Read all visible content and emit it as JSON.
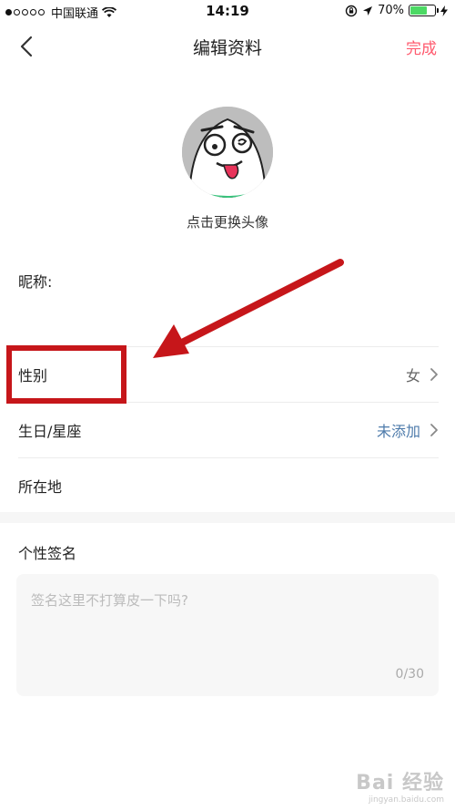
{
  "status_bar": {
    "carrier": "中国联通",
    "time": "14:19",
    "battery": "70%",
    "battery_level": 0.7
  },
  "nav": {
    "title": "编辑资料",
    "done_label": "完成",
    "back_icon": "chevron-left-icon"
  },
  "avatar": {
    "caption": "点击更换头像"
  },
  "form": {
    "nickname_label": "昵称:",
    "gender_label": "性别",
    "gender_value": "女",
    "birthday_label": "生日/星座",
    "birthday_value": "未添加",
    "location_label": "所在地"
  },
  "signature": {
    "title": "个性签名",
    "placeholder": "签名这里不打算皮一下吗?",
    "counter": "0/30"
  },
  "watermark": {
    "main": "Bai 经验",
    "sub": "jingyan.baidu.com"
  },
  "colors": {
    "accent": "#ff5a6e",
    "link_blue": "#4e7bab",
    "annotation_red": "#c6161a"
  }
}
